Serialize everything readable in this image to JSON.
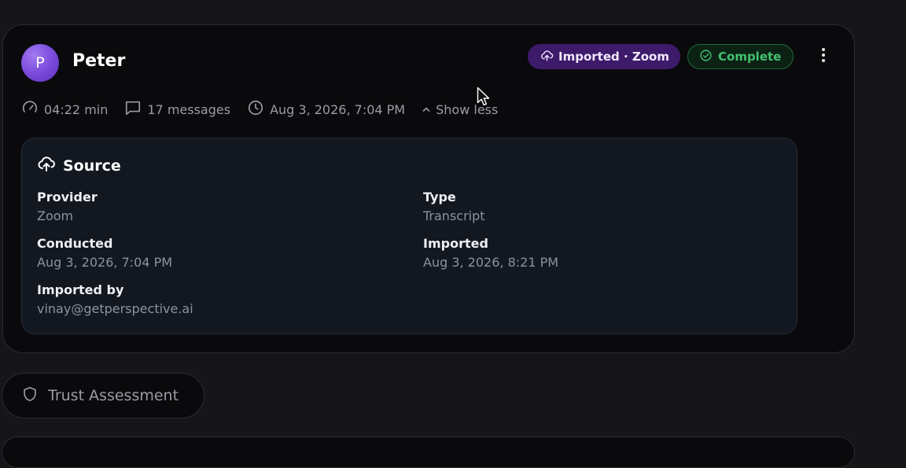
{
  "participant": {
    "avatar_initial": "P",
    "name": "Peter"
  },
  "badges": {
    "imported": "Imported · Zoom",
    "status": "Complete"
  },
  "meta": {
    "duration": "04:22 min",
    "messages": "17 messages",
    "datetime": "Aug 3, 2026, 7:04 PM",
    "toggle": "Show less"
  },
  "source": {
    "title": "Source",
    "provider_label": "Provider",
    "provider_value": "Zoom",
    "type_label": "Type",
    "type_value": "Transcript",
    "conducted_label": "Conducted",
    "conducted_value": "Aug 3, 2026, 7:04 PM",
    "imported_label": "Imported",
    "imported_value": "Aug 3, 2026, 8:21 PM",
    "imported_by_label": "Imported by",
    "imported_by_value": "vinay@getperspective.ai"
  },
  "trust": {
    "label": "Trust Assessment"
  },
  "colors": {
    "background": "#161619",
    "card": "#0a0a0c",
    "imported_badge": "#3e1a6b",
    "complete_green": "#43c06f",
    "avatar_purple": "#7f4fe0"
  }
}
